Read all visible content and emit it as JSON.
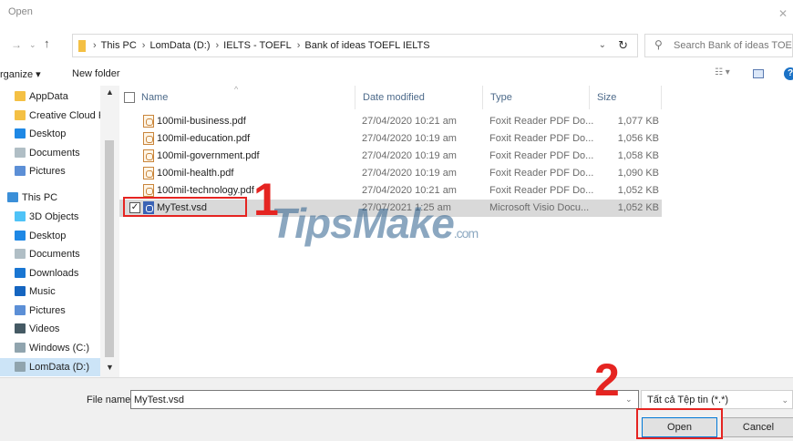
{
  "window": {
    "title": "Open",
    "close_glyph": "✕"
  },
  "address_bar": {
    "back_glyph": "→",
    "dropdown_glyph": "⌄",
    "up_glyph": "↑",
    "breadcrumb": [
      "This PC",
      "LomData (D:)",
      "IELTS - TOEFL",
      "Bank of ideas TOEFL IELTS"
    ],
    "separator": "›",
    "dropdown_arrow": "⌄",
    "refresh_glyph": "↻"
  },
  "search": {
    "placeholder": "Search Bank of ideas TOEFL IELTS",
    "icon_glyph": "⚲"
  },
  "toolbar": {
    "organize_label": "rganize ▾",
    "new_folder_label": "New folder",
    "views_glyph": "☷ ▾",
    "help_glyph": "?"
  },
  "nav_pane": {
    "scroll_up": "▲",
    "scroll_down": "▼",
    "items": [
      {
        "label": "AppData",
        "icon": "folder-icon",
        "color": "#f4c044"
      },
      {
        "label": "Creative Cloud Fi",
        "icon": "folder-icon",
        "color": "#f4c044"
      },
      {
        "label": "Desktop",
        "icon": "desktop-icon",
        "color": "#1e88e5"
      },
      {
        "label": "Documents",
        "icon": "documents-icon",
        "color": "#b0bec5"
      },
      {
        "label": "Pictures",
        "icon": "pictures-icon",
        "color": "#5c8fd6"
      },
      {
        "label": "This PC",
        "icon": "this-pc-icon",
        "color": "#3b8fd8"
      },
      {
        "label": "3D Objects",
        "icon": "3d-objects-icon",
        "color": "#4fc3f7"
      },
      {
        "label": "Desktop",
        "icon": "desktop-icon",
        "color": "#1e88e5"
      },
      {
        "label": "Documents",
        "icon": "documents-icon",
        "color": "#b0bec5"
      },
      {
        "label": "Downloads",
        "icon": "downloads-icon",
        "color": "#1976d2"
      },
      {
        "label": "Music",
        "icon": "music-icon",
        "color": "#1565c0"
      },
      {
        "label": "Pictures",
        "icon": "pictures-icon",
        "color": "#5c8fd6"
      },
      {
        "label": "Videos",
        "icon": "videos-icon",
        "color": "#455a64"
      },
      {
        "label": "Windows (C:)",
        "icon": "drive-icon",
        "color": "#90a4ae"
      },
      {
        "label": "LomData (D:)",
        "icon": "drive-icon",
        "color": "#90a4ae"
      }
    ]
  },
  "file_list": {
    "columns": {
      "name": "Name",
      "date": "Date modified",
      "type": "Type",
      "size": "Size",
      "sort_glyph": "^"
    },
    "rows": [
      {
        "name": "100mil-business.pdf",
        "date": "27/04/2020 10:21 am",
        "type": "Foxit Reader PDF Do...",
        "size": "1,077 KB",
        "icon": "pdf-icon",
        "selected": false
      },
      {
        "name": "100mil-education.pdf",
        "date": "27/04/2020 10:19 am",
        "type": "Foxit Reader PDF Do...",
        "size": "1,056 KB",
        "icon": "pdf-icon",
        "selected": false
      },
      {
        "name": "100mil-government.pdf",
        "date": "27/04/2020 10:19 am",
        "type": "Foxit Reader PDF Do...",
        "size": "1,058 KB",
        "icon": "pdf-icon",
        "selected": false
      },
      {
        "name": "100mil-health.pdf",
        "date": "27/04/2020 10:19 am",
        "type": "Foxit Reader PDF Do...",
        "size": "1,090 KB",
        "icon": "pdf-icon",
        "selected": false
      },
      {
        "name": "100mil-technology.pdf",
        "date": "27/04/2020 10:21 am",
        "type": "Foxit Reader PDF Do...",
        "size": "1,052 KB",
        "icon": "pdf-icon",
        "selected": false
      },
      {
        "name": "MyTest.vsd",
        "date": "27/07/2021 1:25 am",
        "type": "Microsoft Visio Docu...",
        "size": "1,052 KB",
        "icon": "vsd-icon",
        "selected": true,
        "check_glyph": "✓"
      }
    ]
  },
  "bottom_bar": {
    "file_name_label": "File name:",
    "file_name_value": "MyTest.vsd",
    "file_name_dropdown": "⌄",
    "file_type_value": "Tất cả Tệp tin (*.*)",
    "file_type_dropdown": "⌄",
    "open_label": "Open",
    "cancel_label": "Cancel"
  },
  "watermark": {
    "text": "TipsMake",
    "suffix": ".com"
  },
  "annotations": {
    "step1": "1",
    "step2": "2",
    "color": "#e52421"
  }
}
